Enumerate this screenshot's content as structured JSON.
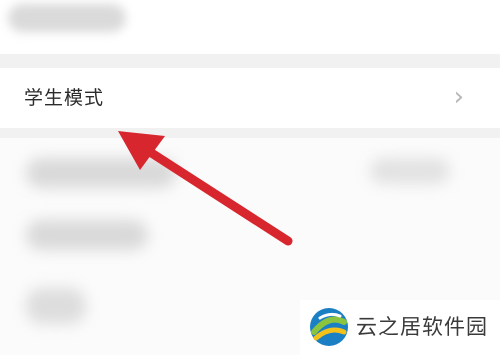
{
  "settings": {
    "student_mode": {
      "label": "学生模式",
      "chevron": "›"
    }
  },
  "annotation": {
    "arrow_color": "#d8262e"
  },
  "watermark": {
    "text": "云之居软件园"
  }
}
